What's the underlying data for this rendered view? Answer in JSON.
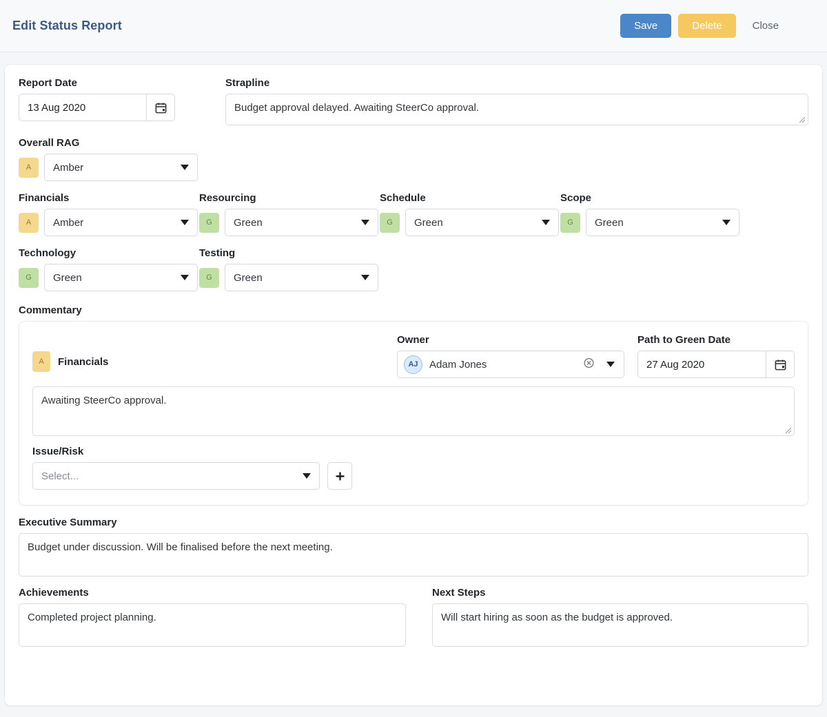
{
  "header": {
    "title": "Edit Status Report",
    "save_label": "Save",
    "delete_label": "Delete",
    "close_label": "Close"
  },
  "form": {
    "report_date": {
      "label": "Report Date",
      "value": "13 Aug 2020"
    },
    "strapline": {
      "label": "Strapline",
      "value": "Budget approval delayed. Awaiting SteerCo approval."
    },
    "overall_rag": {
      "label": "Overall RAG",
      "badge": "A",
      "value": "Amber"
    },
    "rag_fields": [
      {
        "label": "Financials",
        "badge": "A",
        "value": "Amber"
      },
      {
        "label": "Resourcing",
        "badge": "G",
        "value": "Green"
      },
      {
        "label": "Schedule",
        "badge": "G",
        "value": "Green"
      },
      {
        "label": "Scope",
        "badge": "G",
        "value": "Green"
      },
      {
        "label": "Technology",
        "badge": "G",
        "value": "Green"
      },
      {
        "label": "Testing",
        "badge": "G",
        "value": "Green"
      }
    ],
    "commentary": {
      "label": "Commentary",
      "badge": "A",
      "title": "Financials",
      "owner": {
        "label": "Owner",
        "initials": "AJ",
        "name": "Adam Jones"
      },
      "path_to_green": {
        "label": "Path to Green Date",
        "value": "27 Aug 2020"
      },
      "text": "Awaiting SteerCo approval.",
      "issue_risk": {
        "label": "Issue/Risk",
        "placeholder": "Select...",
        "add_label": "+"
      }
    },
    "executive_summary": {
      "label": "Executive Summary",
      "value": "Budget under discussion. Will be finalised before the next meeting."
    },
    "achievements": {
      "label": "Achievements",
      "value": "Completed project planning."
    },
    "next_steps": {
      "label": "Next Steps",
      "value": "Will start hiring as soon as the budget is approved."
    }
  },
  "colors": {
    "accent_blue": "#4a86c8",
    "delete_amber": "#f5c95f",
    "title_blue": "#3d5a80",
    "rag_amber": "#f5d78e",
    "rag_green": "#bfe0a2"
  }
}
